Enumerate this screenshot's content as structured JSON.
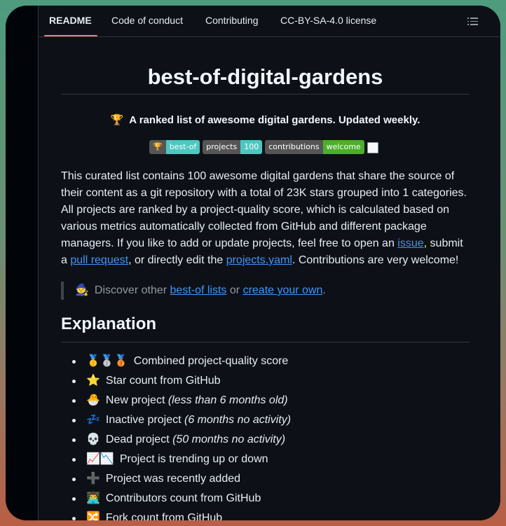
{
  "tabs": [
    {
      "label": "README",
      "active": true
    },
    {
      "label": "Code of conduct",
      "active": false
    },
    {
      "label": "Contributing",
      "active": false
    },
    {
      "label": "CC-BY-SA-4.0 license",
      "active": false
    }
  ],
  "readme": {
    "title": "best-of-digital-gardens",
    "tagline_icon": "🏆",
    "tagline": "A ranked list of awesome digital gardens. Updated weekly.",
    "badges": [
      {
        "label": "🏆",
        "value": "best-of",
        "color": "#4ec7c1"
      },
      {
        "label": "projects",
        "value": "100",
        "color": "#4ec7c1"
      },
      {
        "label": "contributions",
        "value": "welcome",
        "color": "#4caf2c"
      }
    ],
    "intro": {
      "text1": "This curated list contains 100 awesome digital gardens that share the source of their content as a git repository with a total of 23K stars grouped into 1 categories. All projects are ranked by a project-quality score, which is calculated based on various metrics automatically collected from GitHub and different package managers. If you like to add or update projects, feel free to open an ",
      "link_issue": "issue",
      "text2": ", submit a ",
      "link_pr": "pull request",
      "text3": ", or directly edit the ",
      "link_yaml": "projects.yaml",
      "text4": ". Contributions are very welcome!"
    },
    "quote": {
      "icon": "🧙",
      "text1": "Discover other ",
      "link1": "best-of lists",
      "text2": " or ",
      "link2": "create your own",
      "text3": "."
    },
    "explanation_heading": "Explanation",
    "legend": [
      {
        "icon": "🥇🥈🥉",
        "text": "Combined project-quality score",
        "note": ""
      },
      {
        "icon": "⭐️",
        "text": "Star count from GitHub",
        "note": ""
      },
      {
        "icon": "🐣",
        "text": "New project ",
        "note": "(less than 6 months old)"
      },
      {
        "icon": "💤",
        "text": "Inactive project ",
        "note": "(6 months no activity)"
      },
      {
        "icon": "💀",
        "text": "Dead project ",
        "note": "(50 months no activity)"
      },
      {
        "icon": "📈📉",
        "text": "Project is trending up or down",
        "note": ""
      },
      {
        "icon": "➕",
        "text": "Project was recently added",
        "note": ""
      },
      {
        "icon": "👨‍💻",
        "text": "Contributors count from GitHub",
        "note": ""
      },
      {
        "icon": "🔀",
        "text": "Fork count from GitHub",
        "note": ""
      }
    ]
  },
  "colors": {
    "accent": "#f78166",
    "link": "#4493f8",
    "background": "#0d1117"
  }
}
